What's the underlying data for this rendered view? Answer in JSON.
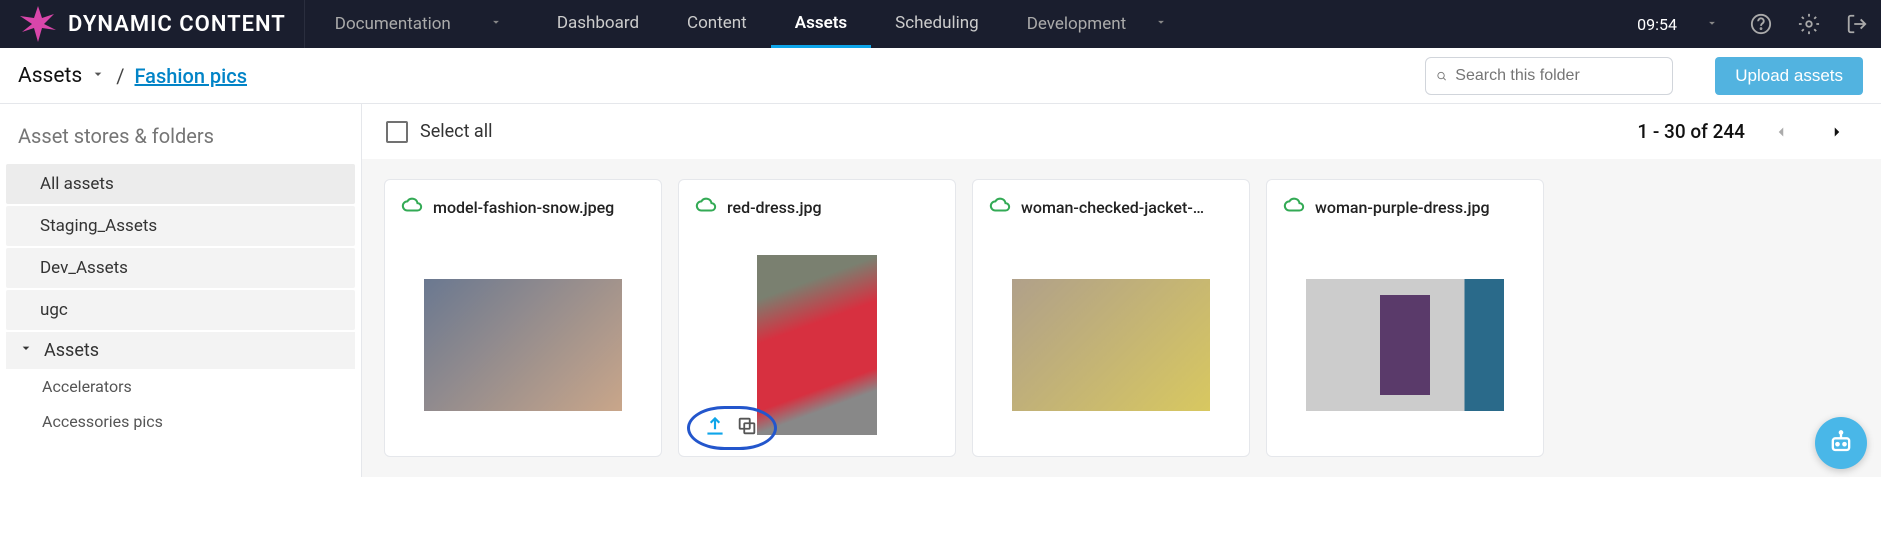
{
  "header": {
    "logo_text": "DYNAMIC CONTENT",
    "docs_label": "Documentation",
    "nav": [
      {
        "label": "Dashboard",
        "active": false
      },
      {
        "label": "Content",
        "active": false
      },
      {
        "label": "Assets",
        "active": true
      },
      {
        "label": "Scheduling",
        "active": false
      }
    ],
    "dev_label": "Development",
    "time": "09:54"
  },
  "breadcrumb": {
    "root": "Assets",
    "sep": "/",
    "current_link": "Fashion pics"
  },
  "search": {
    "placeholder": "Search this folder"
  },
  "upload_label": "Upload assets",
  "sidebar": {
    "title": "Asset stores & folders",
    "stores": [
      "All assets",
      "Staging_Assets",
      "Dev_Assets",
      "ugc"
    ],
    "tree_label": "Assets",
    "subitems": [
      "Accelerators",
      "Accessories pics"
    ]
  },
  "toolbar": {
    "select_all": "Select all",
    "range": "1 - 30 of 244"
  },
  "assets": [
    {
      "name": "model-fashion-snow.jpeg",
      "thumb_style": "wide",
      "color_a": "#6a7890",
      "color_b": "#c9a68a"
    },
    {
      "name": "red-dress.jpg",
      "thumb_style": "tall",
      "color_a": "#d73040",
      "color_b": "#7a8070",
      "show_actions": true
    },
    {
      "name": "woman-checked-jacket-…",
      "thumb_style": "wide",
      "color_a": "#b0a08a",
      "color_b": "#d8c860"
    },
    {
      "name": "woman-purple-dress.jpg",
      "thumb_style": "wide",
      "color_a": "#5a3a6a",
      "color_b": "#2a6a8a"
    }
  ]
}
